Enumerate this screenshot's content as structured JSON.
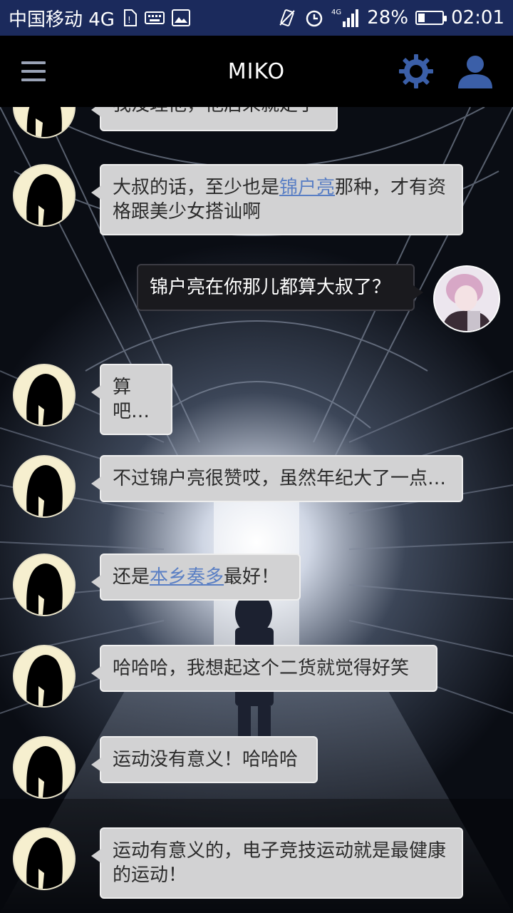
{
  "status_bar": {
    "carrier": "中国移动 4G",
    "network_label": "4G",
    "battery": "28%",
    "battery_level": 0.28,
    "time": "02:01"
  },
  "app_bar": {
    "title": "MIKO",
    "icons": [
      "menu-icon",
      "gear-icon",
      "profile-icon"
    ]
  },
  "messages": [
    {
      "side": "in",
      "text": "我没理他，他后来就走了"
    },
    {
      "side": "in",
      "pre": "大叔的话，至少也是",
      "link": "锦户亮",
      "post": "那种，才有资格跟美少女搭讪啊"
    },
    {
      "side": "out",
      "text": "锦户亮在你那儿都算大叔了？"
    },
    {
      "side": "in",
      "text": "算吧…"
    },
    {
      "side": "in",
      "text": "不过锦户亮很赞哎，虽然年纪大了一点…"
    },
    {
      "side": "in",
      "pre": "还是",
      "link": "本乡奏多",
      "post": "最好！"
    },
    {
      "side": "in",
      "text": "哈哈哈，我想起这个二货就觉得好笑"
    },
    {
      "side": "in",
      "text": "运动没有意义！哈哈哈"
    },
    {
      "side": "in",
      "text": "运动有意义的，电子竞技运动就是最健康的运动！"
    }
  ],
  "colors": {
    "status_bar": "#1b2a5c",
    "app_bar": "#000000",
    "bubble_in": "#d2d2d3",
    "bubble_out": "#1a1a1e",
    "link": "#5a7fc4"
  }
}
